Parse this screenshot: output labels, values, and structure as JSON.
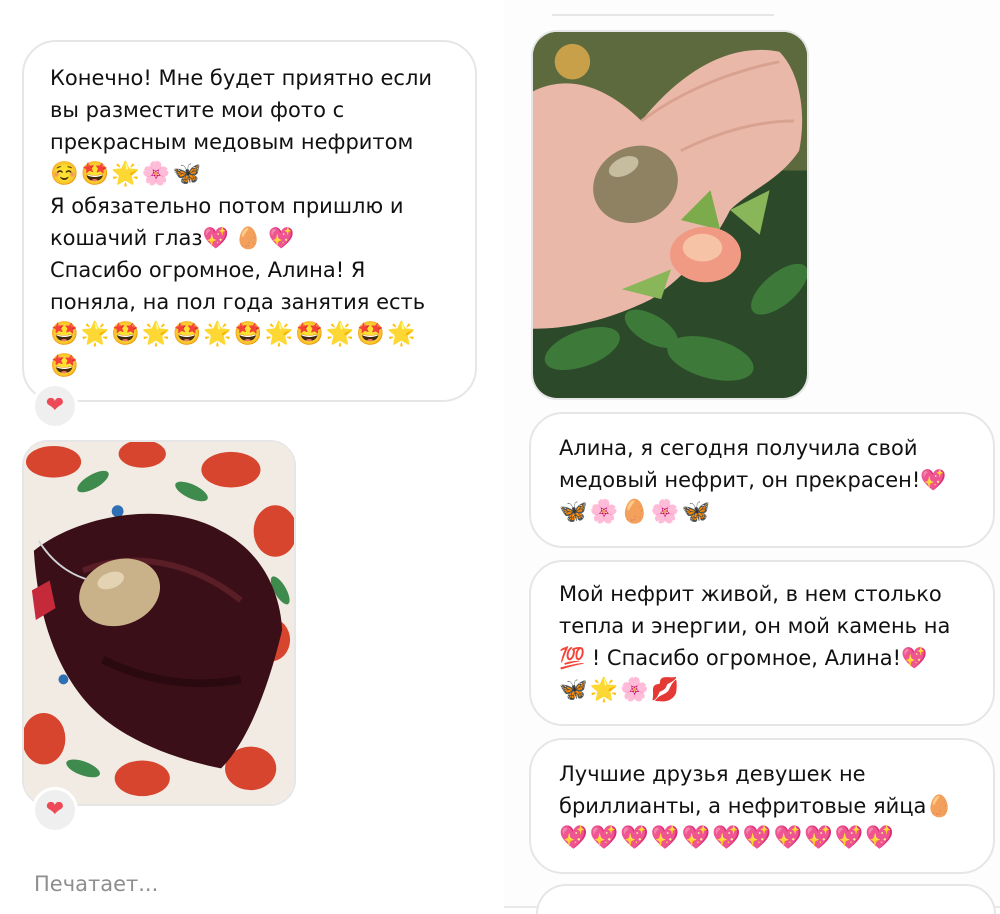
{
  "left_column": {
    "message_1": {
      "lines": [
        "Конечно! Мне будет приятно если",
        "вы разместите мои фото с",
        "прекрасным медовым нефритом"
      ],
      "emoji_1": "☺️🤩🌟🌸🦋",
      "lines_2": [
        "Я обязательно потом пришлю и",
        "кошачий глаз💖 🥚 💖",
        "Спасибо огромное, Алина! Я",
        "поняла, на пол года занятия есть"
      ],
      "emoji_2": "🤩🌟🤩🌟🤩🌟🤩🌟🤩🌟🤩🌟",
      "emoji_3": "🤩",
      "reaction": "❤"
    },
    "photo_reaction": "❤",
    "typing_status": "Печатает..."
  },
  "right_column": {
    "message_2": {
      "lines": [
        "Алина, я сегодня получила свой",
        "медовый нефрит, он прекрасен!💖"
      ],
      "emoji": "🦋🌸🥚🌸🦋"
    },
    "message_3": {
      "lines": [
        "Мой нефрит живой, в нем столько",
        "тепла и энергии, он мой камень на",
        "💯 ! Спасибо огромное, Алина!💖"
      ],
      "emoji": "🦋🌟🌸💋"
    },
    "message_4": {
      "lines": [
        "Лучшие друзья девушек не",
        "бриллианты, а нефритовые яйца🥚"
      ],
      "emoji": "💖💖💖💖💖💖💖💖💖💖💖"
    }
  },
  "colors": {
    "bubble_border": "#e6e6e6",
    "heart": "#ed4956",
    "typing_text": "#8e8e8e",
    "velvet": "#3b0f17",
    "jade_stone": "#c9b28a"
  },
  "icons": [
    "heart-icon"
  ]
}
